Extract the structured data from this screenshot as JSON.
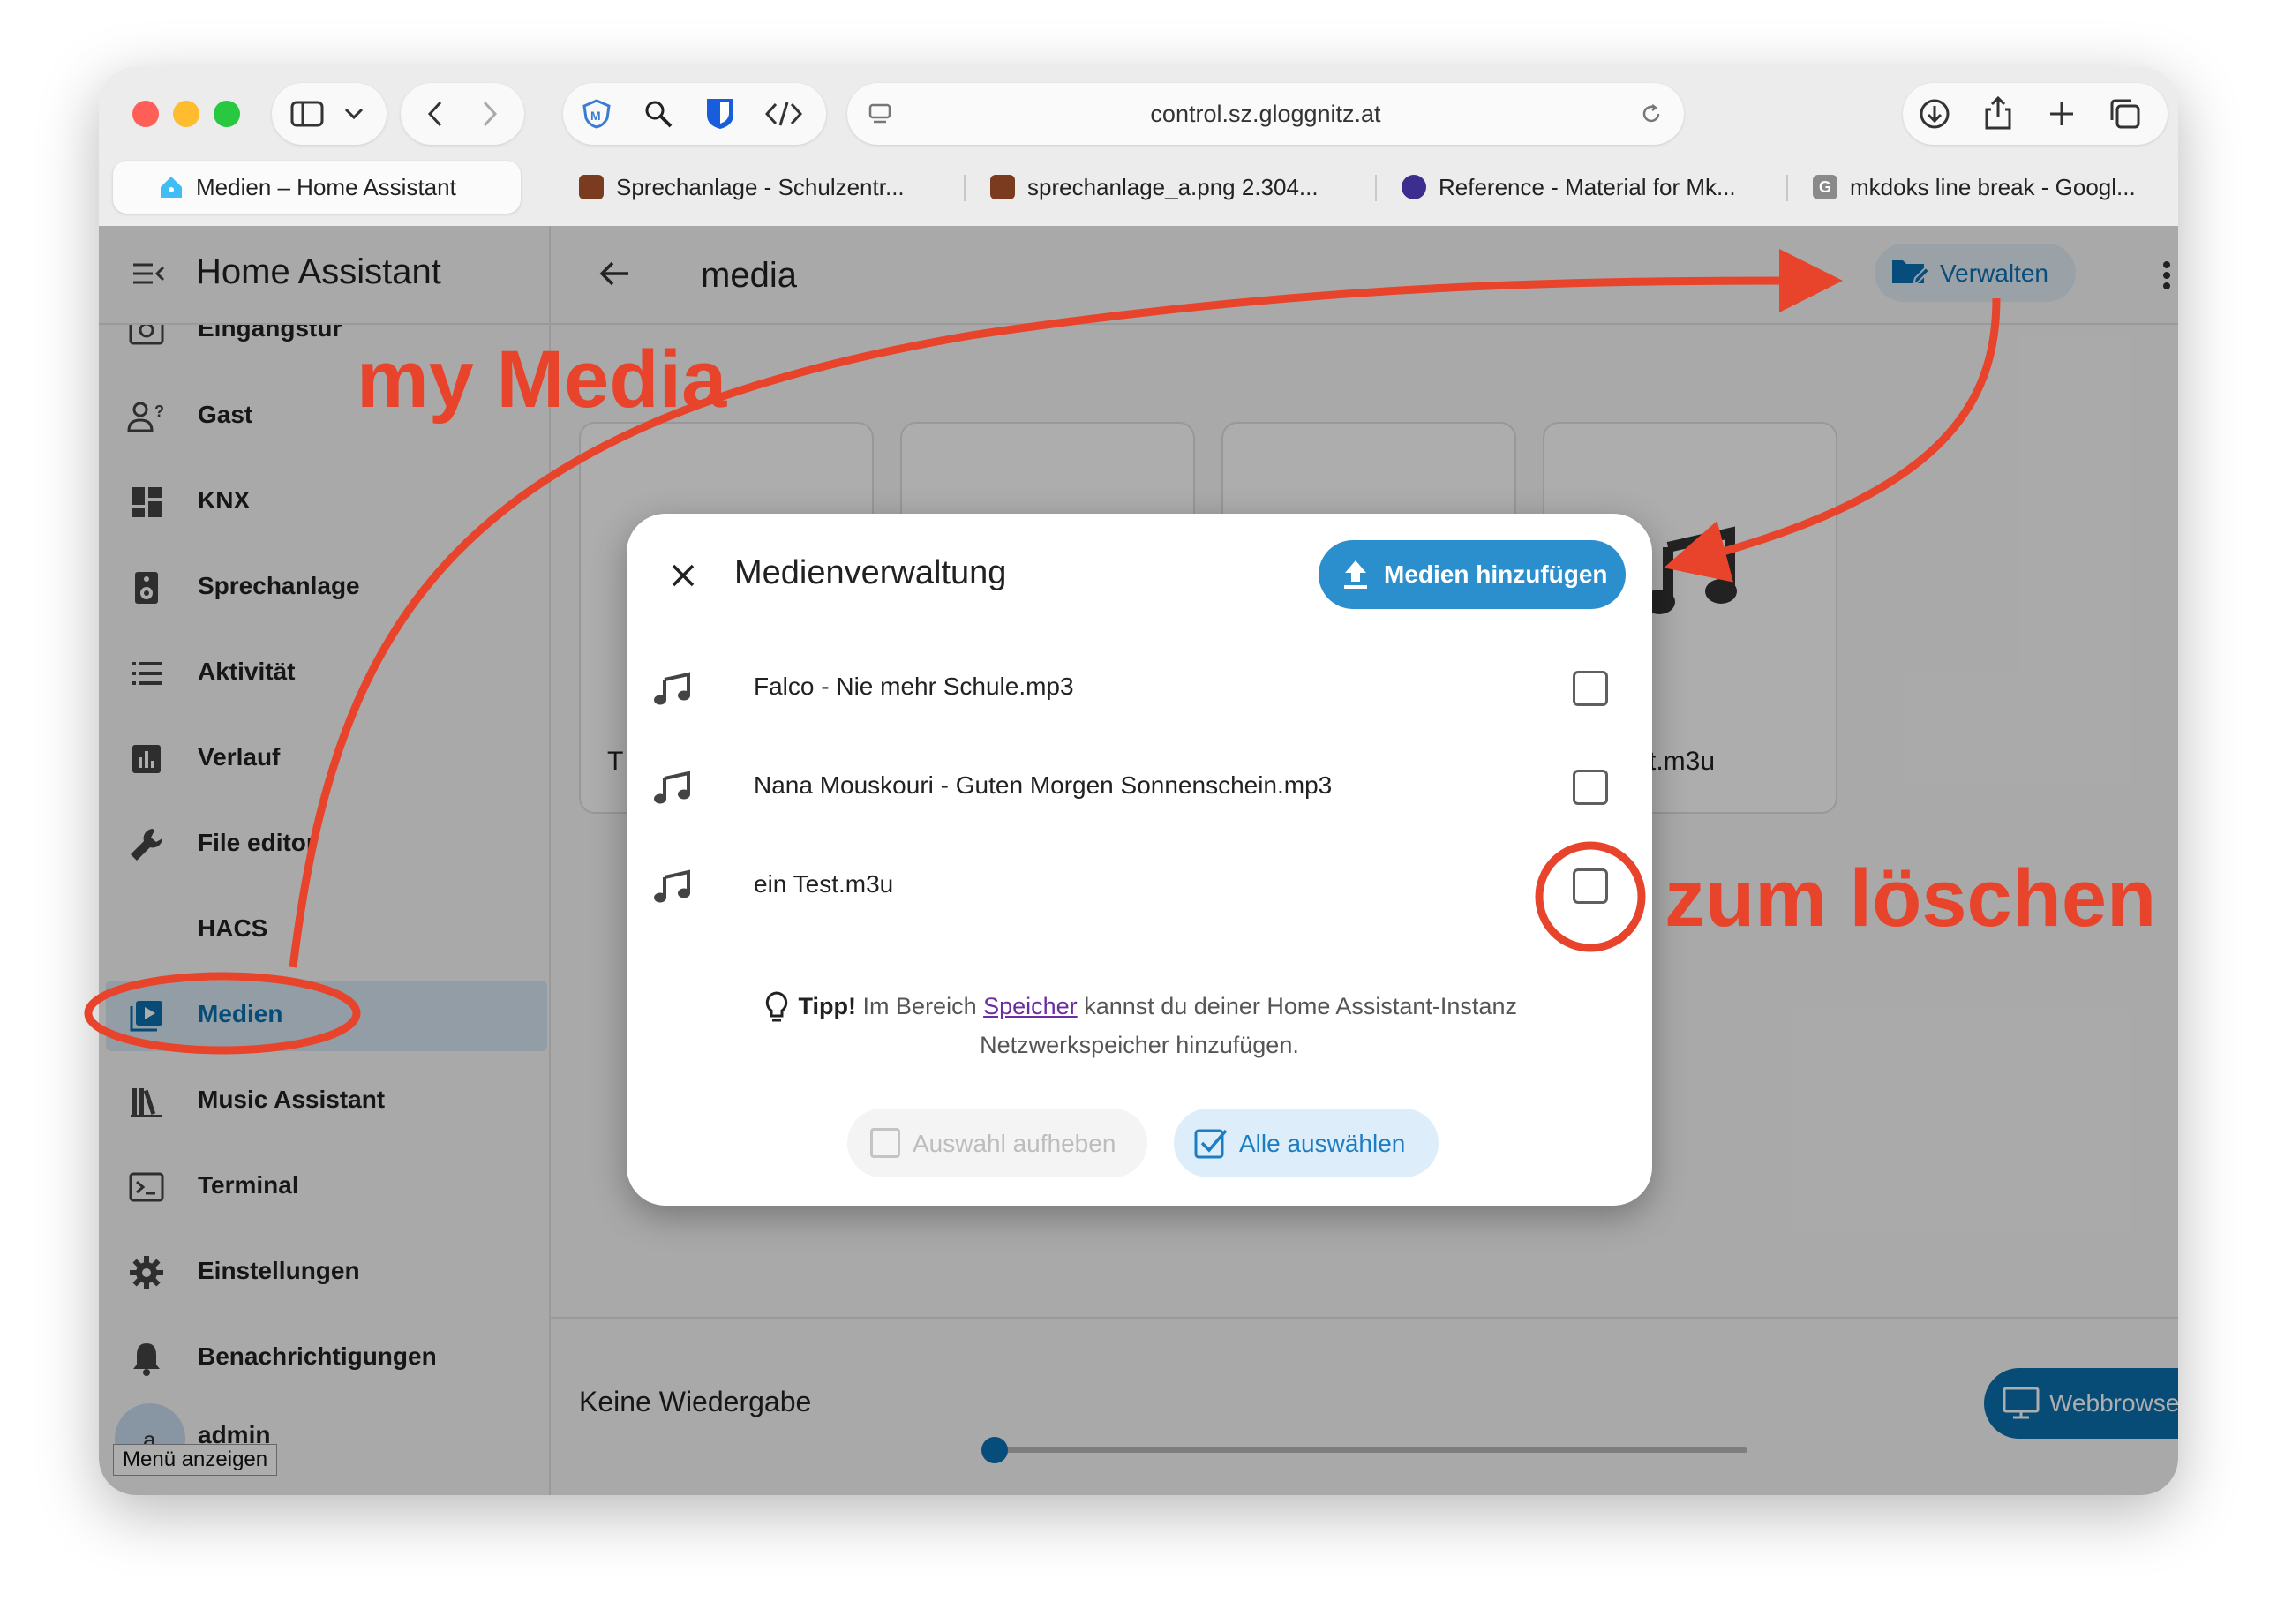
{
  "browser": {
    "url": "control.sz.gloggnitz.at",
    "tabs": [
      {
        "label": "Medien – Home Assistant",
        "active": true
      },
      {
        "label": "Sprechanlage - Schulzentr...",
        "active": false
      },
      {
        "label": "sprechanlage_a.png 2.304...",
        "active": false
      },
      {
        "label": "Reference - Material for Mk...",
        "active": false
      },
      {
        "label": "mkdoks line break - Googl...",
        "active": false
      }
    ]
  },
  "sidebar": {
    "title": "Home Assistant",
    "items": [
      {
        "label": "Eingangstür",
        "icon": "camera-icon"
      },
      {
        "label": "Gast",
        "icon": "account-question-icon"
      },
      {
        "label": "KNX",
        "icon": "dashboard-icon"
      },
      {
        "label": "Sprechanlage",
        "icon": "speaker-icon"
      },
      {
        "label": "Aktivität",
        "icon": "list-icon"
      },
      {
        "label": "Verlauf",
        "icon": "chart-icon"
      },
      {
        "label": "File editor",
        "icon": "wrench-icon"
      },
      {
        "label": "HACS",
        "icon": ""
      },
      {
        "label": "Medien",
        "icon": "play-box-icon",
        "selected": true
      },
      {
        "label": "Music Assistant",
        "icon": "library-icon"
      },
      {
        "label": "Terminal",
        "icon": "console-icon"
      },
      {
        "label": "Einstellungen",
        "icon": "gear-icon"
      },
      {
        "label": "Benachrichtigungen",
        "icon": "bell-icon"
      }
    ],
    "user": {
      "initial": "a",
      "name": "admin"
    },
    "tooltip": "Menü anzeigen"
  },
  "main": {
    "title": "media",
    "manage_label": "Verwalten",
    "cards": [
      {
        "label": "T"
      },
      {
        "label": ""
      },
      {
        "label": ""
      },
      {
        "label": "t.m3u"
      }
    ]
  },
  "player": {
    "status": "Keine Wiedergabe",
    "target_label": "Webbrowser"
  },
  "dialog": {
    "title": "Medienverwaltung",
    "add_label": "Medien hinzufügen",
    "files": [
      {
        "name": "Falco - Nie mehr Schule.mp3",
        "checked": false
      },
      {
        "name": "Nana Mouskouri - Guten Morgen Sonnenschein.mp3",
        "checked": false
      },
      {
        "name": "ein Test.m3u",
        "checked": false
      }
    ],
    "tip": {
      "bold": "Tipp!",
      "text_before": "Im Bereich",
      "link": "Speicher",
      "text_after": "kannst du deiner Home Assistant-Instanz",
      "line2": "Netzwerkspeicher hinzufügen."
    },
    "deselect_label": "Auswahl aufheben",
    "select_all_label": "Alle auswählen"
  },
  "annotations": {
    "my_media": "my Media",
    "zum_loeschen": "zum löschen",
    "color": "#e8432b"
  }
}
